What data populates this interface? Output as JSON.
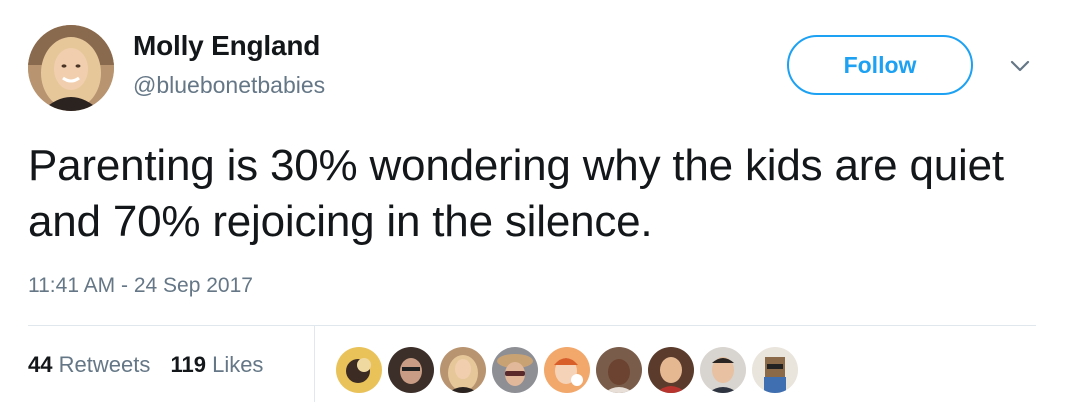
{
  "user": {
    "display_name": "Molly England",
    "handle": "@bluebonetbabies"
  },
  "follow_label": "Follow",
  "tweet": {
    "text": "Parenting is 30% wondering why the kids are quiet and 70% rejoicing in the silence.",
    "timestamp": "11:41 AM - 24 Sep 2017"
  },
  "stats": {
    "retweets_count": "44",
    "retweets_label": "Retweets",
    "likes_count": "119",
    "likes_label": "Likes"
  },
  "icons": {
    "caret": "chevron-down-icon"
  },
  "colors": {
    "accent": "#1da1f2",
    "text": "#14171a",
    "secondary": "#657786",
    "divider": "#e1e8ed"
  }
}
